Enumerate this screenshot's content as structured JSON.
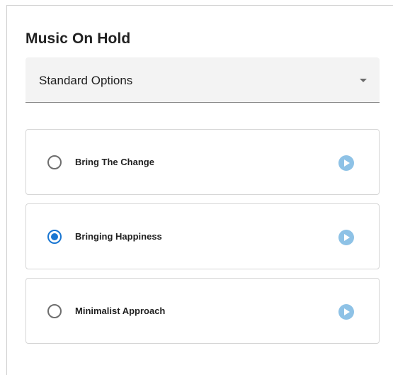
{
  "section": {
    "title": "Music On Hold"
  },
  "select": {
    "value": "Standard Options",
    "icon": "chevron-down-icon"
  },
  "options": [
    {
      "label": "Bring The Change",
      "selected": false,
      "action_icon": "play-icon"
    },
    {
      "label": "Bringing Happiness",
      "selected": true,
      "action_icon": "play-icon"
    },
    {
      "label": "Minimalist Approach",
      "selected": false,
      "action_icon": "play-icon"
    }
  ],
  "colors": {
    "accent": "#1976d2",
    "play_button": "#8ec2e6",
    "select_background": "#f3f3f3"
  }
}
